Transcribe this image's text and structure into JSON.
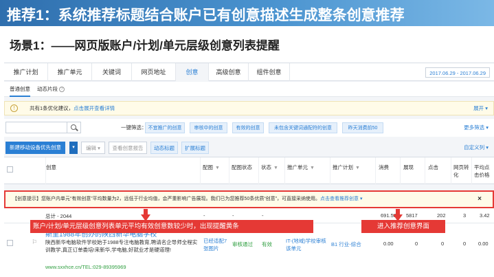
{
  "banner": {
    "title": "推荐1：系统推荐标题结合账户已有创意描述生成整条创意推荐"
  },
  "scene": {
    "title": "场景1：——网页版账户/计划/单元层级创意列表提醒"
  },
  "tabs": [
    {
      "label": "推广计划"
    },
    {
      "label": "推广单元"
    },
    {
      "label": "关键词"
    },
    {
      "label": "网页地址"
    },
    {
      "label": "创意"
    },
    {
      "label": "高级创意"
    },
    {
      "label": "组件创意"
    }
  ],
  "date_range": "2017.06.29 - 2017.06.29",
  "subtabs": [
    {
      "label": "普通创意"
    },
    {
      "label": "动态片段"
    }
  ],
  "suggest": {
    "text": "共有1条优化建议，",
    "link": "点击展开查看详情",
    "expand": "展开"
  },
  "filter": {
    "label": "一键筛选：",
    "chips": [
      "不宜推广的创意",
      "审核中的创意",
      "有效的创意",
      "未包含关键词通配符的创意",
      "昨天消费前50"
    ],
    "more": "更多筛选"
  },
  "toolbar": {
    "primary": "新建移动设备优先创意",
    "edit": "编辑",
    "report": "查看创意报告",
    "dynamic_title": "动态标题",
    "ext_title": "扩展标题",
    "custom_cols": "自定义列"
  },
  "table": {
    "headers": {
      "idea": "创意",
      "match": "配图",
      "status": "配图状态",
      "state": "状态",
      "unit": "推广单元",
      "plan": "推广计划",
      "cost": "消费",
      "impr": "展现",
      "click": "点击",
      "conv": "网页转化",
      "avg": "平均点击价格"
    }
  },
  "tip": {
    "text": "【创意提示】您账户内单元“有效创意”平均数量为2，远低于行业均值，会严重影响广告展现。我们已为您推荐50条优质“创意”，可直接采纳使用。",
    "link": "点击查看推荐创意",
    "close": "×"
  },
  "total_row": {
    "label": "总计 - 2044",
    "dash1": "-",
    "dash2": "-",
    "dash3": "-",
    "cost": "691.58",
    "impr": "5817",
    "click": "202",
    "conv": "3",
    "avg": "3.42"
  },
  "data_row": {
    "title": "斯里1988年创办的陕西新华电脑学校",
    "desc": "陕西新华电脑软件学校始于1988专注电脑教育,聘请名企导师全程实训教学,真正订单委培!来新华,学电脑,好就业才是硬道理!",
    "url": "www.sxxhce.cn/TEL:029-89395969",
    "match": "已经适配7张图片",
    "img_status": "审核通过",
    "state": "有效",
    "unit": "IT-(地域)学校审核该单元",
    "plan": "B1 行业-综合",
    "cost": "0.00",
    "impr": "0",
    "click": "0",
    "conv": "0",
    "avg": "0.00"
  },
  "callouts": {
    "left": "账户/计划/单元层级创意列表单元平均有效创意数较少时，出现提醒黄条",
    "right": "进入推荐创意界面"
  },
  "colors": {
    "accent": "#2a7fd4",
    "alert": "#e53935",
    "banner": "#3f83c4"
  }
}
